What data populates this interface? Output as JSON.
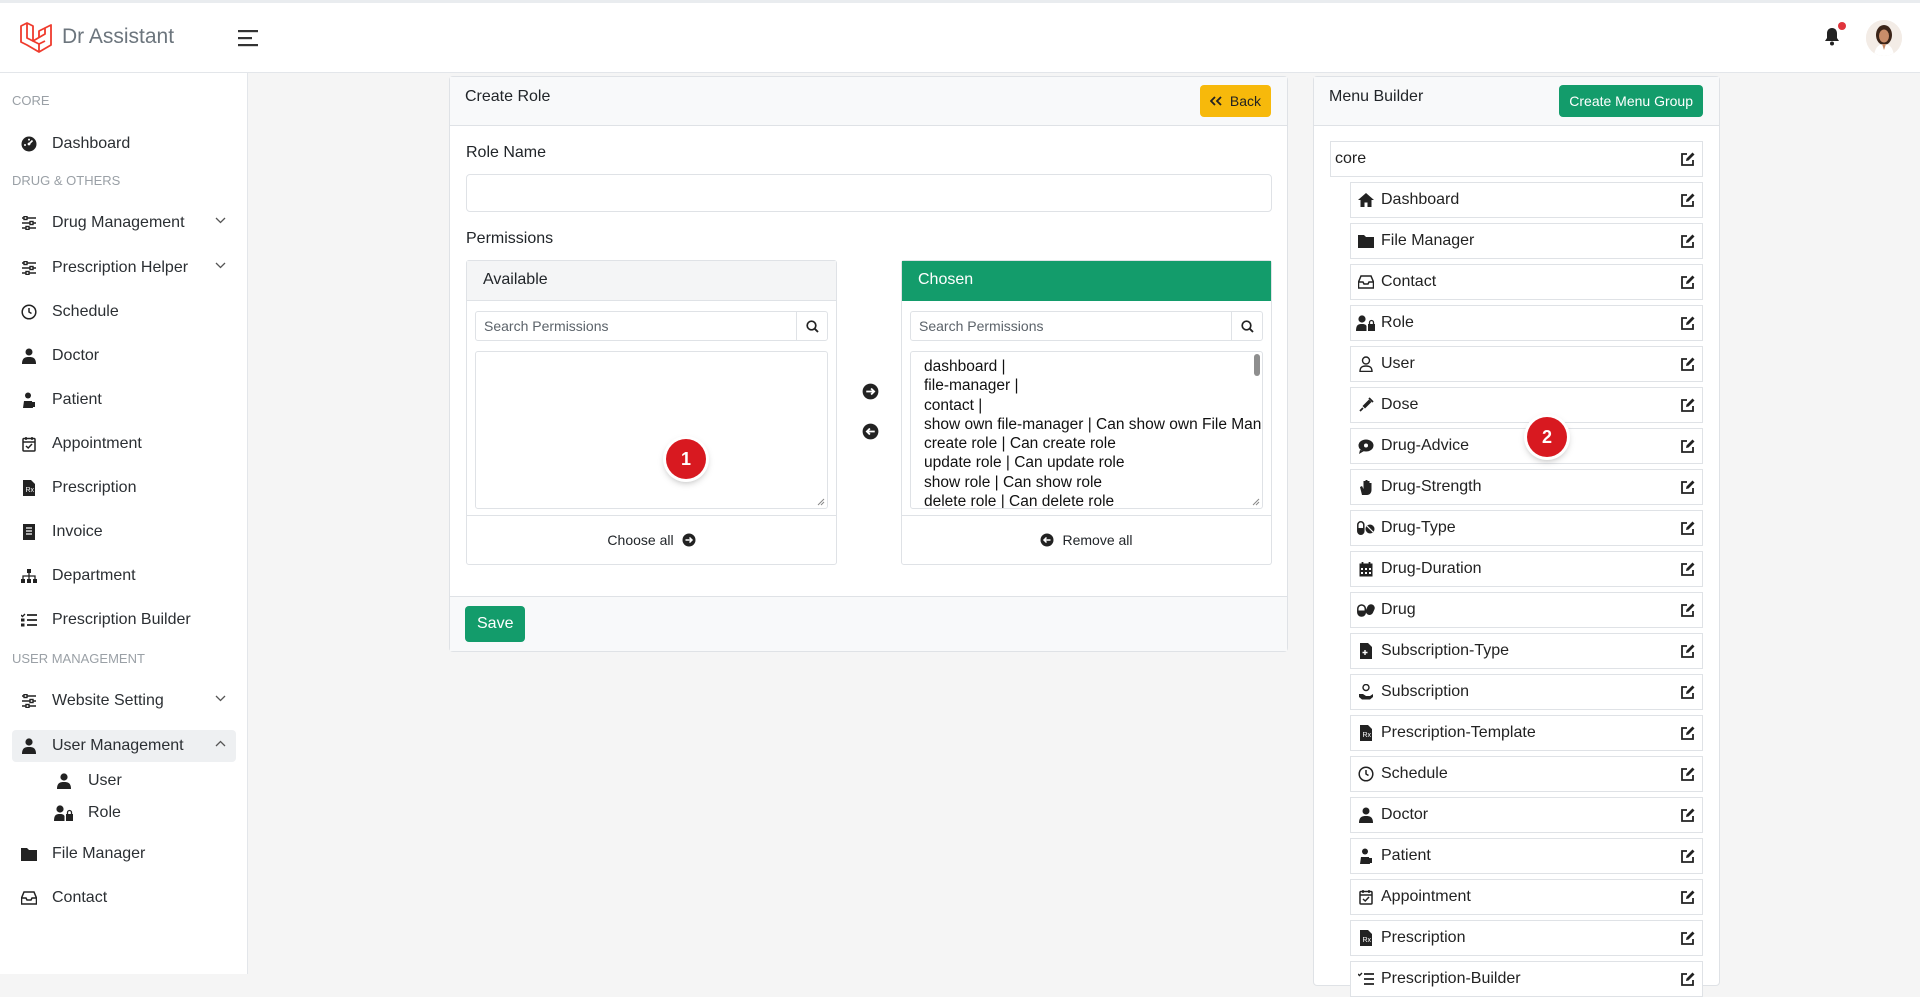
{
  "header": {
    "brand": "Dr Assistant"
  },
  "sidebar": {
    "sections": [
      "CORE",
      "DRUG & OTHERS",
      "USER MANAGEMENT"
    ],
    "items": [
      {
        "label": "Dashboard",
        "icon": "dashboard-icon"
      },
      {
        "label": "Drug Management",
        "icon": "sliders-icon",
        "dropdown": true
      },
      {
        "label": "Prescription Helper",
        "icon": "sliders-icon",
        "dropdown": true
      },
      {
        "label": "Schedule",
        "icon": "clock-icon"
      },
      {
        "label": "Doctor",
        "icon": "doctor-icon"
      },
      {
        "label": "Patient",
        "icon": "patient-icon"
      },
      {
        "label": "Appointment",
        "icon": "calendar-check-icon"
      },
      {
        "label": "Prescription",
        "icon": "file-prescription-icon"
      },
      {
        "label": "Invoice",
        "icon": "receipt-icon"
      },
      {
        "label": "Department",
        "icon": "sitemap-icon"
      },
      {
        "label": "Prescription Builder",
        "icon": "list-check-icon"
      },
      {
        "label": "Website Setting",
        "icon": "sliders-icon",
        "dropdown": true
      },
      {
        "label": "User Management",
        "icon": "user-icon",
        "expanded": true
      },
      {
        "label": "File Manager",
        "icon": "folder-icon"
      },
      {
        "label": "Contact",
        "icon": "inbox-icon"
      }
    ],
    "sub_items": [
      {
        "label": "User",
        "icon": "user-icon"
      },
      {
        "label": "Role",
        "icon": "user-lock-icon"
      }
    ]
  },
  "create_role": {
    "title": "Create Role",
    "back_label": "Back",
    "role_name_label": "Role Name",
    "role_name_value": "",
    "permissions_label": "Permissions",
    "available": {
      "title": "Available",
      "search_placeholder": "Search Permissions",
      "footer_label": "Choose all",
      "options": []
    },
    "chosen": {
      "title": "Chosen",
      "search_placeholder": "Search Permissions",
      "footer_label": "Remove all",
      "options": [
        "dashboard |",
        "file-manager |",
        "contact |",
        "show own file-manager | Can show own File Manager",
        "create role | Can create role",
        "update role | Can update role",
        "show role | Can show role",
        "delete role | Can delete role"
      ]
    },
    "save_label": "Save"
  },
  "menu_builder": {
    "title": "Menu Builder",
    "create_group_label": "Create Menu Group",
    "group": "core",
    "items": [
      {
        "label": "Dashboard",
        "icon": "home-icon"
      },
      {
        "label": "File Manager",
        "icon": "folder-icon"
      },
      {
        "label": "Contact",
        "icon": "inbox-icon"
      },
      {
        "label": "Role",
        "icon": "user-lock-icon"
      },
      {
        "label": "User",
        "icon": "user-icon"
      },
      {
        "label": "Dose",
        "icon": "syringe-icon"
      },
      {
        "label": "Drug-Advice",
        "icon": "comment-icon"
      },
      {
        "label": "Drug-Strength",
        "icon": "hand-icon"
      },
      {
        "label": "Drug-Type",
        "icon": "pills-icon"
      },
      {
        "label": "Drug-Duration",
        "icon": "calendar-icon"
      },
      {
        "label": "Drug",
        "icon": "capsules-icon"
      },
      {
        "label": "Subscription-Type",
        "icon": "file-icon"
      },
      {
        "label": "Subscription",
        "icon": "hand-holding-icon"
      },
      {
        "label": "Prescription-Template",
        "icon": "file-prescription-icon"
      },
      {
        "label": "Schedule",
        "icon": "clock-icon"
      },
      {
        "label": "Doctor",
        "icon": "doctor-icon"
      },
      {
        "label": "Patient",
        "icon": "patient-icon"
      },
      {
        "label": "Appointment",
        "icon": "calendar-check-icon"
      },
      {
        "label": "Prescription",
        "icon": "file-prescription-icon"
      },
      {
        "label": "Prescription-Builder",
        "icon": "list-check-icon"
      }
    ]
  },
  "badges": [
    "1",
    "2"
  ],
  "colors": {
    "primary": "#139c6b",
    "warning": "#f7b90b",
    "badge": "#d81920"
  }
}
